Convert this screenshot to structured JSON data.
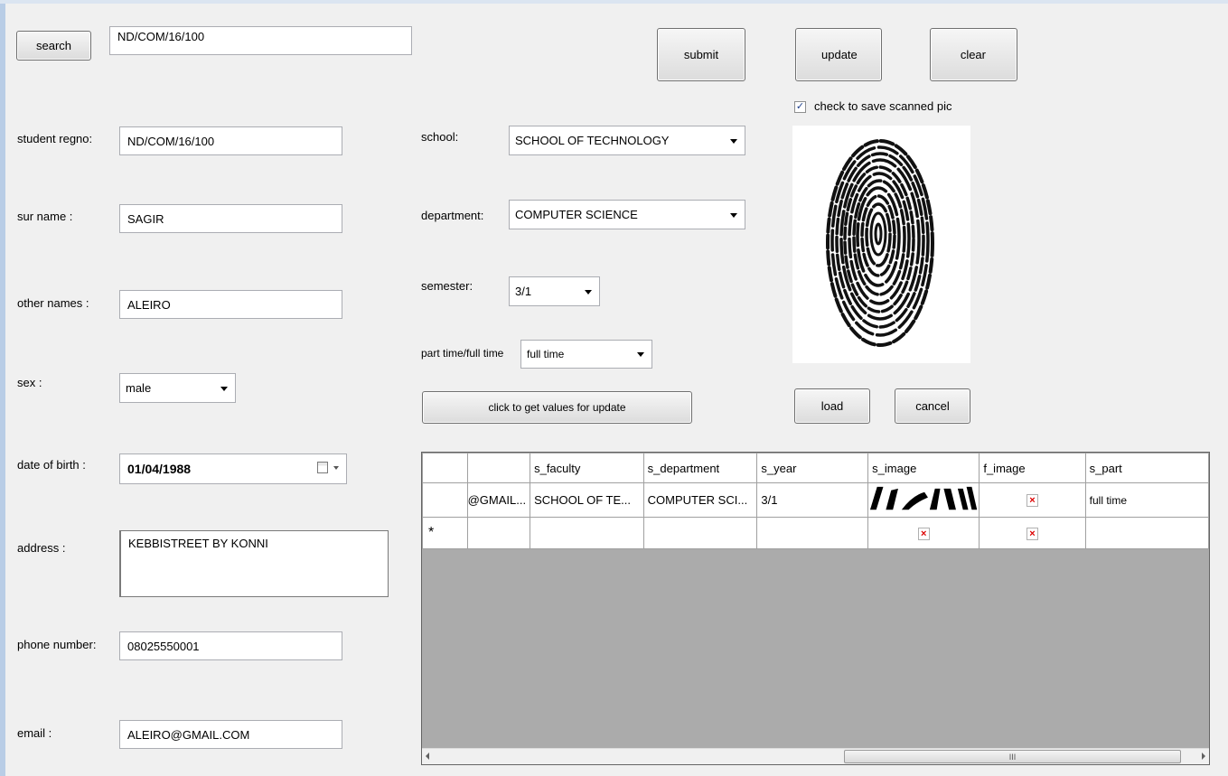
{
  "search": {
    "button_label": "search",
    "value": "ND/COM/16/100"
  },
  "actions": {
    "submit": "submit",
    "update": "update",
    "clear": "clear",
    "get_values": "click to get values for update",
    "load": "load",
    "cancel": "cancel"
  },
  "fields": {
    "regno": {
      "label": "student regno:",
      "value": "ND/COM/16/100"
    },
    "surname": {
      "label": "sur name :",
      "value": "SAGIR"
    },
    "othernames": {
      "label": "other names :",
      "value": "ALEIRO"
    },
    "sex": {
      "label": "sex :",
      "value": "male"
    },
    "dob": {
      "label": "date of birth :",
      "value": "01/04/1988"
    },
    "address": {
      "label": "address :",
      "value": "KEBBISTREET BY KONNI"
    },
    "phone": {
      "label": "phone number:",
      "value": "08025550001"
    },
    "email": {
      "label": "email :",
      "value": "ALEIRO@GMAIL.COM"
    },
    "school": {
      "label": "school:",
      "value": "SCHOOL OF TECHNOLOGY"
    },
    "department": {
      "label": "department:",
      "value": "COMPUTER SCIENCE"
    },
    "semester": {
      "label": "semester:",
      "value": "3/1"
    },
    "parttime": {
      "label": "part time/full time",
      "value": "full time"
    }
  },
  "scan": {
    "checkbox_label": "check to save scanned pic",
    "checked": true
  },
  "grid": {
    "columns": [
      "",
      "s_faculty",
      "s_department",
      "s_year",
      "s_image",
      "f_image",
      "s_part"
    ],
    "rows": [
      [
        "@GMAIL...",
        "SCHOOL OF TE...",
        "COMPUTER SCI...",
        "3/1",
        "",
        "",
        "full time"
      ],
      [
        "",
        "",
        "",
        "",
        "",
        "",
        ""
      ]
    ],
    "new_row_marker": "*",
    "scroll_thumb_label": "III"
  }
}
